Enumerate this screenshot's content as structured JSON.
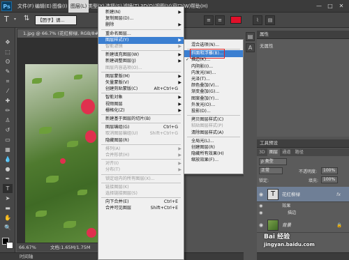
{
  "app": {
    "logo": "Ps"
  },
  "menubar": {
    "items": [
      "文件(F)",
      "编辑(E)",
      "图像(I)",
      "图层(L)",
      "类型(Y)",
      "选择(S)",
      "滤镜(T)",
      "3D(D)",
      "视图(V)",
      "窗口(W)",
      "帮助(H)"
    ],
    "active": "图层(L)"
  },
  "window_controls": [
    "—",
    "□",
    "✕"
  ],
  "options_bar": {
    "tool_icon": "T-icon",
    "layer_field": "【团子】请...",
    "color_accent": "#e0102a"
  },
  "document": {
    "tab_title": "1.jpg @ 66.7% (花红柳绿, RGB/8#) *",
    "zoom": "66.67%",
    "doc_info": "文档:1.65M/1.75M",
    "timeline_label": "时间轴"
  },
  "layer_menu": [
    {
      "label": "新建(N)",
      "arrow": true
    },
    {
      "label": "复制图层(D)..."
    },
    {
      "label": "删除",
      "arrow": true
    },
    {
      "sep": true
    },
    {
      "label": "重命名图层..."
    },
    {
      "label": "图层样式(Y)",
      "arrow": true,
      "highlight": true
    },
    {
      "label": "智能滤镜",
      "arrow": true,
      "disabled": true
    },
    {
      "sep": true
    },
    {
      "label": "新建填充图层(W)",
      "arrow": true
    },
    {
      "label": "新建调整图层(J)",
      "arrow": true
    },
    {
      "label": "图层内容选项(O)...",
      "disabled": true
    },
    {
      "sep": true
    },
    {
      "label": "图层蒙版(M)",
      "arrow": true
    },
    {
      "label": "矢量蒙版(V)",
      "arrow": true
    },
    {
      "label": "创建剪贴蒙版(C)",
      "shortcut": "Alt+Ctrl+G"
    },
    {
      "sep": true
    },
    {
      "label": "智能对象",
      "arrow": true
    },
    {
      "label": "视频图层",
      "arrow": true
    },
    {
      "label": "栅格化(Z)",
      "arrow": true
    },
    {
      "sep": true
    },
    {
      "label": "新建基于图层的切片(B)"
    },
    {
      "sep": true
    },
    {
      "label": "图层编组(G)",
      "shortcut": "Ctrl+G"
    },
    {
      "label": "取消图层编组(U)",
      "shortcut": "Shift+Ctrl+G",
      "disabled": true
    },
    {
      "label": "隐藏图层(R)"
    },
    {
      "sep": true
    },
    {
      "label": "排列(A)",
      "arrow": true,
      "disabled": true
    },
    {
      "label": "合并形状(H)",
      "arrow": true,
      "disabled": true
    },
    {
      "sep": true
    },
    {
      "label": "对齐(I)",
      "arrow": true,
      "disabled": true
    },
    {
      "label": "分布(T)",
      "arrow": true,
      "disabled": true
    },
    {
      "sep": true
    },
    {
      "label": "锁定组内的所有图层(X)...",
      "disabled": true
    },
    {
      "sep": true
    },
    {
      "label": "链接图层(K)",
      "disabled": true
    },
    {
      "label": "选择链接图层(S)",
      "disabled": true
    },
    {
      "sep": true
    },
    {
      "label": "向下合并(E)",
      "shortcut": "Ctrl+E"
    },
    {
      "label": "合并可见图层",
      "shortcut": "Shift+Ctrl+E"
    }
  ],
  "style_submenu": [
    {
      "label": "混合选项(N)..."
    },
    {
      "sep": true
    },
    {
      "label": "斜面和浮雕(B)...",
      "highlight": true,
      "boxed": true
    },
    {
      "label": "描边(K)...",
      "checked": true
    },
    {
      "label": "内阴影(I)..."
    },
    {
      "label": "内发光(W)..."
    },
    {
      "label": "光泽(T)..."
    },
    {
      "label": "颜色叠加(V)..."
    },
    {
      "label": "渐变叠加(G)..."
    },
    {
      "label": "图案叠加(Y)..."
    },
    {
      "label": "外发光(O)..."
    },
    {
      "label": "投影(D)..."
    },
    {
      "sep": true
    },
    {
      "label": "拷贝图层样式(C)"
    },
    {
      "label": "粘贴图层样式(P)",
      "disabled": true
    },
    {
      "label": "清除图层样式(A)"
    },
    {
      "sep": true
    },
    {
      "label": "全局光(L)..."
    },
    {
      "label": "创建图层(R)"
    },
    {
      "label": "隐藏所有效果(H)"
    },
    {
      "label": "缩放效果(F)..."
    }
  ],
  "properties_panel": {
    "title": "属性",
    "body": "无属性"
  },
  "layers_panel": {
    "header": "工具预设",
    "tabs": [
      "3D",
      "图层",
      "通道",
      "路径"
    ],
    "active_tab": "图层",
    "filter_label": "ρ 类型",
    "blend_mode": "正常",
    "opacity_label": "不透明度:",
    "opacity_value": "100%",
    "lock_label": "锁定:",
    "fill_label": "填充:",
    "fill_value": "100%",
    "layers": [
      {
        "name": "花红柳绿",
        "thumb": "T",
        "selected": true,
        "fx": "fx"
      },
      {
        "name": "背景",
        "thumb": "",
        "selected": false
      }
    ],
    "effects_label": "效果",
    "effect_item": "描边"
  },
  "watermark": {
    "brand": "Bai 经验",
    "url": "jingyan.baidu.com"
  }
}
